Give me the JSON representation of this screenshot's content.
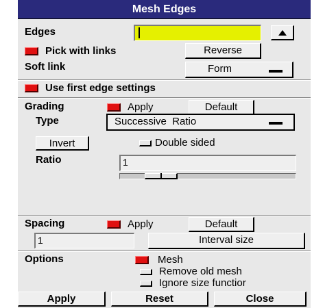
{
  "window": {
    "title": "Mesh Edges"
  },
  "edges": {
    "label": "Edges",
    "value": "",
    "expand_icon": "up-triangle-icon"
  },
  "pick_with_links": {
    "label": "Pick with links",
    "checked": true
  },
  "reverse_button": "Reverse",
  "soft_link": {
    "label": "Soft link",
    "selected": "Form"
  },
  "use_first_edge": {
    "label": "Use first edge settings",
    "checked": true
  },
  "grading": {
    "label": "Grading",
    "apply_label": "Apply",
    "apply_checked": true,
    "default_button": "Default",
    "type_label": "Type",
    "type_selected": "Successive  Ratio",
    "invert_button": "Invert",
    "double_sided_label": "Double sided",
    "double_sided_checked": false,
    "ratio_label": "Ratio",
    "ratio_value": "1"
  },
  "spacing": {
    "label": "Spacing",
    "apply_label": "Apply",
    "apply_checked": true,
    "default_button": "Default",
    "value": "1",
    "unit_selected": "Interval size"
  },
  "options": {
    "label": "Options",
    "mesh_label": "Mesh",
    "mesh_checked": true,
    "remove_old_mesh_label": "Remove old mesh",
    "remove_old_mesh_checked": false,
    "ignore_size_label": "Ignore size functior",
    "ignore_size_checked": false
  },
  "footer": {
    "apply": "Apply",
    "reset": "Reset",
    "close": "Close"
  },
  "colors": {
    "title_bar": "#2a2a7c",
    "checked_red": "#e01010",
    "edges_field_highlight": "#e5f000"
  }
}
